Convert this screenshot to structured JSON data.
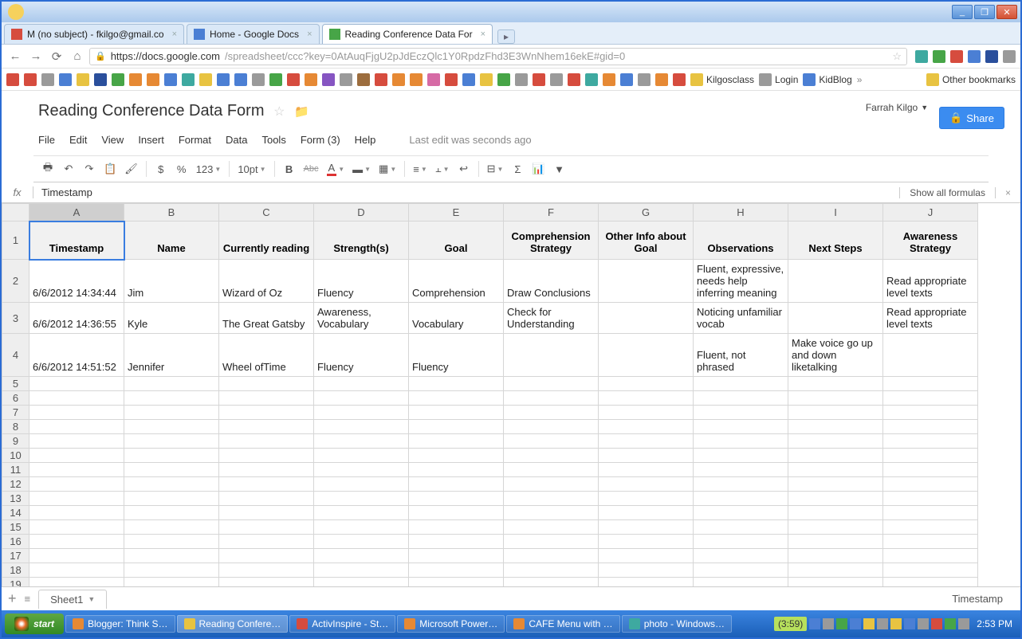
{
  "window": {
    "min": "_",
    "max": "❐",
    "close": "✕"
  },
  "tabs": [
    {
      "title": "M (no subject) - fkilgo@gmail.co"
    },
    {
      "title": "Home - Google Docs"
    },
    {
      "title": "Reading Conference Data For"
    }
  ],
  "url": {
    "host": "https://docs.google.com",
    "path": "/spreadsheet/ccc?key=0AtAuqFjgU2pJdEczQlc1Y0RpdzFhd3E3WnNhem16ekE#gid=0",
    "star": "☆"
  },
  "bookmarks": {
    "kilgosclass": "Kilgosclass",
    "login": "Login",
    "kidblog": "KidBlog",
    "other": "Other bookmarks"
  },
  "doc": {
    "title": "Reading Conference Data Form",
    "account": "Farrah Kilgo",
    "share": "Share",
    "menus": [
      "File",
      "Edit",
      "View",
      "Insert",
      "Format",
      "Data",
      "Tools",
      "Form (3)",
      "Help"
    ],
    "status": "Last edit was seconds ago"
  },
  "toolbar": {
    "dollar": "$",
    "pct": "%",
    "num": "123",
    "font": "10pt",
    "bold": "B",
    "abc": "Abc"
  },
  "fx": {
    "label": "fx",
    "value": "Timestamp",
    "show": "Show all formulas",
    "close": "×"
  },
  "columns": [
    "A",
    "B",
    "C",
    "D",
    "E",
    "F",
    "G",
    "H",
    "I",
    "J"
  ],
  "headers": [
    "Timestamp",
    "Name",
    "Currently reading",
    "Strength(s)",
    "Goal",
    "Comprehension Strategy",
    "Other Info about Goal",
    "Observations",
    "Next Steps",
    "Awareness Strategy"
  ],
  "rows": [
    {
      "n": 2,
      "cells": [
        "6/6/2012 14:34:44",
        "Jim",
        "Wizard of Oz",
        "Fluency",
        "Comprehension",
        "Draw Conclusions",
        "",
        "Fluent, expressive, needs help inferring meaning",
        "",
        "Read appropriate level texts"
      ]
    },
    {
      "n": 3,
      "cells": [
        "6/6/2012 14:36:55",
        "Kyle",
        "The Great Gatsby",
        "Awareness, Vocabulary",
        "Vocabulary",
        "Check for Understanding",
        "",
        "Noticing unfamiliar vocab",
        "",
        "Read appropriate level texts"
      ]
    },
    {
      "n": 4,
      "cells": [
        "6/6/2012 14:51:52",
        "Jennifer",
        "Wheel ofTime",
        "Fluency",
        "Fluency",
        "",
        "",
        "Fluent, not phrased",
        "Make voice go up and down liketalking",
        ""
      ]
    }
  ],
  "emptyRows": [
    5,
    6,
    7,
    8,
    9,
    10,
    11,
    12,
    13,
    14,
    15,
    16,
    17,
    18,
    19
  ],
  "sheet": {
    "add": "+",
    "menu": "≡",
    "tab": "Sheet1",
    "status": "Timestamp"
  },
  "taskbar": {
    "start": "start",
    "items": [
      "Blogger: Think S…",
      "Reading Confere…",
      "ActivInspire - St…",
      "Microsoft Power…",
      "CAFE Menu with …",
      "photo - Windows…"
    ],
    "time_badge": "(3:59)",
    "clock": "2:53 PM"
  }
}
